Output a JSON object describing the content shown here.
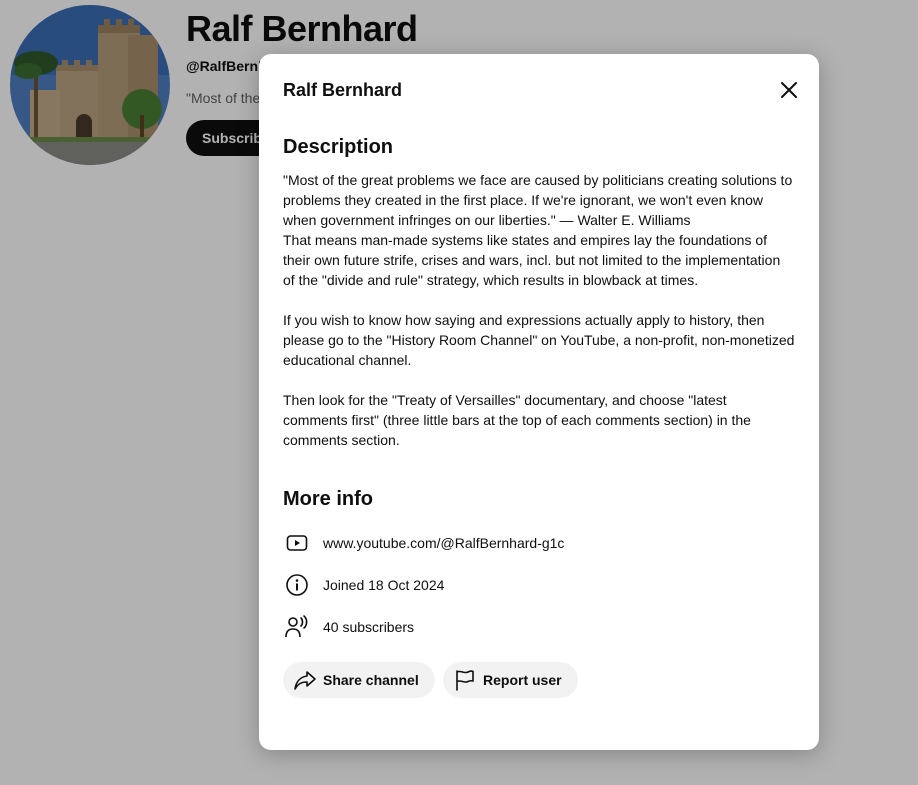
{
  "channel": {
    "name": "Ralf Bernhard",
    "handle": "@RalfBernh",
    "description_preview": "\"Most of the",
    "subscribe_label": "Subscribe"
  },
  "dialog": {
    "title": "Ralf Bernhard",
    "description_heading": "Description",
    "description_text": "\"Most of the great problems we face are caused by politicians creating solutions to problems they created in the first place. If we're ignorant, we won't even know when government infringes on our liberties.\" — Walter E. Williams\nThat means man-made systems like states and empires lay the foundations of their own future strife, crises and wars, incl. but not limited to the implementation of the \"divide and rule\" strategy, which results in blowback at times.\n\nIf you wish to know how saying and expressions actually apply to history, then please go to the \"History Room Channel\" on YouTube, a non-profit, non-monetized educational channel.\n\nThen look for the \"Treaty of Versailles\" documentary, and choose \"latest comments first\" (three little bars at the top of each comments section) in the comments section.",
    "more_info_heading": "More info",
    "channel_url": "www.youtube.com/@RalfBernhard-g1c",
    "joined": "Joined 18 Oct 2024",
    "subscribers": "40 subscribers",
    "share_label": "Share channel",
    "report_label": "Report user"
  },
  "icons": {
    "close": "close-icon",
    "url": "youtube-play-icon",
    "joined": "info-icon",
    "subscribers": "person-broadcast-icon",
    "share": "share-arrow-icon",
    "report": "flag-icon"
  },
  "colors": {
    "overlay": "rgba(0,0,0,0.30)",
    "pill_bg": "#f2f2f2",
    "text": "#0f0f0f",
    "muted": "#606060"
  }
}
